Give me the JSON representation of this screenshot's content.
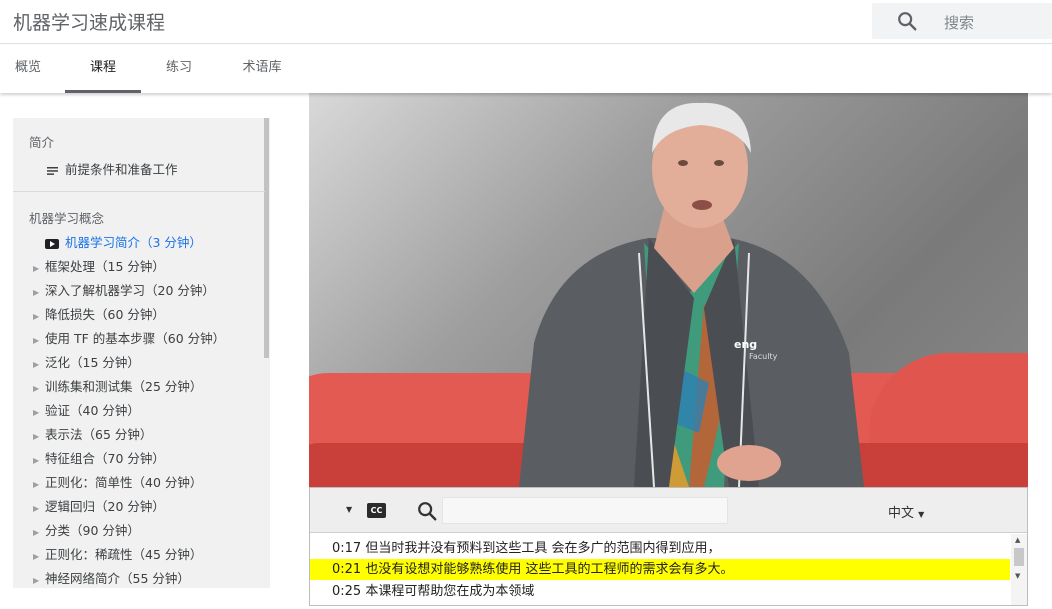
{
  "header": {
    "title": "机器学习速成课程",
    "search_placeholder": "搜索"
  },
  "tabs": [
    {
      "label": "概览"
    },
    {
      "label": "课程"
    },
    {
      "label": "练习"
    },
    {
      "label": "术语库"
    }
  ],
  "sidebar": {
    "intro_title": "简介",
    "intro_item": "前提条件和准备工作",
    "concepts_title": "机器学习概念",
    "items": [
      {
        "label": "机器学习简介（3 分钟）"
      },
      {
        "label": "框架处理（15 分钟）"
      },
      {
        "label": "深入了解机器学习（20 分钟）"
      },
      {
        "label": "降低损失（60 分钟）"
      },
      {
        "label": "使用 TF 的基本步骤（60 分钟）"
      },
      {
        "label": "泛化（15 分钟）"
      },
      {
        "label": "训练集和测试集（25 分钟）"
      },
      {
        "label": "验证（40 分钟）"
      },
      {
        "label": "表示法（65 分钟）"
      },
      {
        "label": "特征组合（70 分钟）"
      },
      {
        "label": "正则化：简单性（40 分钟）"
      },
      {
        "label": "逻辑回归（20 分钟）"
      },
      {
        "label": "分类（90 分钟）"
      },
      {
        "label": "正则化：稀疏性（45 分钟）"
      },
      {
        "label": "神经网络简介（55 分钟）"
      }
    ]
  },
  "video": {
    "shirt_text": "Faculty",
    "shirt_brand": "eng"
  },
  "transcript": {
    "cc_label": "CC",
    "language": "中文",
    "lines": [
      {
        "time": "0:17",
        "text": "但当时我并没有预料到这些工具 会在多广的范围内得到应用，"
      },
      {
        "time": "0:21",
        "text": "也没有设想对能够熟练使用 这些工具的工程师的需求会有多大。"
      },
      {
        "time": "0:25",
        "text": "本课程可帮助您在成为本领域"
      }
    ]
  },
  "colors": {
    "highlight": "#ffff00",
    "active_link": "#1a73e8"
  }
}
